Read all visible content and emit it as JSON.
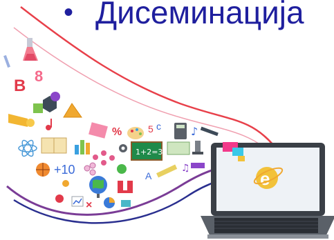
{
  "slide": {
    "bullet": "•",
    "title": "Дисеминација"
  },
  "illustration": {
    "icons": [
      "flask-icon",
      "letter-b-icon",
      "number-8-icon",
      "hexagon-icon",
      "ruler-triangle-icon",
      "trumpet-icon",
      "music-note-icon",
      "book-icon",
      "bar-chart-icon",
      "percent-icon",
      "palette-icon",
      "calculator-icon",
      "microscope-icon",
      "atom-icon",
      "molecule-icon",
      "gear-icon",
      "chalkboard-icon",
      "basketball-icon",
      "globe-icon",
      "apple-icon",
      "magnet-icon",
      "laptop-icon",
      "ie-logo-icon"
    ],
    "chalkboard_text": "1+2=3",
    "numbers_text": "+10",
    "fraction_text": "5",
    "fraction_text2": "c",
    "letter_a": "A",
    "letter_b": "B",
    "number_8": "8",
    "percent_text": "%",
    "ie_letter": "e",
    "colors": {
      "title": "#1f1f9e",
      "swoosh_red": "#e8404a",
      "swoosh_blue": "#2a2f8f",
      "swoosh_purple": "#7a3c96",
      "laptop_body": "#3a3f46",
      "screen": "#eef2f6"
    }
  }
}
